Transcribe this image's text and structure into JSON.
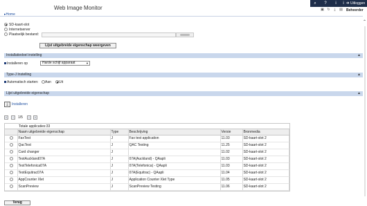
{
  "header": {
    "app_title": "Web Image Monitor",
    "logout_label": "Uitloggen",
    "admin_label": "Beheerder",
    "toolbar_icons": [
      "search-icon",
      "help-icon",
      "info-icon",
      "info-icon-2",
      "logout-icon"
    ],
    "admin_icons": [
      "lock-icon",
      "refresh-icon",
      "download-icon",
      "document-icon"
    ]
  },
  "breadcrumb": {
    "home": "Home"
  },
  "source": {
    "options": [
      {
        "label": "SD-kaart-slot",
        "selected": true
      },
      {
        "label": "Internetserver",
        "selected": false
      },
      {
        "label": "Plaatselijk bestand",
        "selected": false
      }
    ],
    "file_suffix": ":",
    "show_button": "Lijst uitgebreide eigenschap weergeven"
  },
  "install_settings": {
    "title": "Installatiedoel instelling",
    "field_label": "Installeren op",
    "select_value": "Harde schijf apparaat"
  },
  "type_settings": {
    "title": "Type-J Instelling",
    "field_label": "Automatisch starten:",
    "on_label": "Aan",
    "off_label": "Uit",
    "selected": "Uit"
  },
  "extended_list": {
    "title": "Lijst uitgebreide eigenschap",
    "install_button": "Installeren",
    "pager": {
      "text": "1/5"
    },
    "total": "Totale applicaties:33",
    "columns": [
      "Naam uitgebreide eigenschap",
      "Type",
      "Beschrijving",
      "Versie",
      "Bronmedia"
    ],
    "rows": [
      [
        "FaxTest",
        "J",
        "Fax test application",
        "11.03",
        "SD-kaart-slot 2"
      ],
      [
        "QacTest",
        "J",
        "QAC Testing",
        "11.25",
        "SD-kaart-slot 2"
      ],
      [
        "Card changer",
        "J",
        "",
        "11.02",
        "SD-kaart-slot 2"
      ],
      [
        "TestAuckland07A",
        "J",
        "07A(Auckland) - QAapli",
        "11.03",
        "SD-kaart-slot 2"
      ],
      [
        "TestTelefonica07A",
        "J",
        "07A(Telefonica) - QAapli",
        "11.03",
        "SD-kaart-slot 2"
      ],
      [
        "TestEquitrac07A",
        "J",
        "07A(Equitrac) - QAapli",
        "11.04",
        "SD-kaart-slot 2"
      ],
      [
        "AppCounter Xlet",
        "J",
        "Application Counter Xlet Type",
        "11.05",
        "SD-kaart-slot 2"
      ],
      [
        "ScanPreview",
        "J",
        "ScanPreview Testing",
        "11.06",
        "SD-kaart-slot 2"
      ]
    ]
  },
  "footer": {
    "back_button": "Terug"
  }
}
